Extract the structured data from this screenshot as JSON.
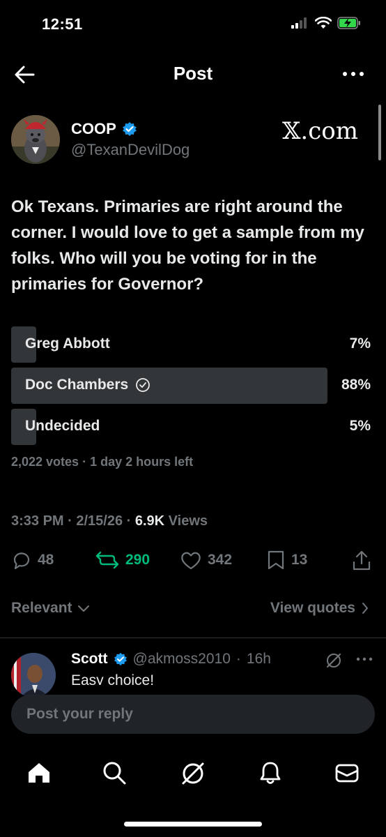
{
  "status_bar": {
    "time": "12:51"
  },
  "header": {
    "title": "Post"
  },
  "author": {
    "name": "COOP",
    "handle": "@TexanDevilDog",
    "verified": true
  },
  "watermark": "𝕏.com",
  "post": {
    "text": "Ok Texans. Primaries are right around the corner. I would love to get a sample from my folks. Who will you be voting for in the primaries for Governor?"
  },
  "poll": {
    "options": [
      {
        "label": "Greg Abbott",
        "percent": "7%",
        "fraction": 0.07
      },
      {
        "label": "Doc Chambers",
        "percent": "88%",
        "fraction": 0.88,
        "winner": true
      },
      {
        "label": "Undecided",
        "percent": "5%",
        "fraction": 0.05
      }
    ],
    "meta": "2,022 votes · 1 day 2 hours left"
  },
  "meta": {
    "time_date": "3:33 PM · 2/15/26 · ",
    "views_count": "6.9K",
    "views_label": " Views"
  },
  "actions": {
    "replies": "48",
    "reposts": "290",
    "likes": "342",
    "bookmarks": "13"
  },
  "colors": {
    "repost_green": "#00ba7c",
    "verified_blue": "#1d9bf0",
    "muted": "#71767b"
  },
  "sort": {
    "label": "Relevant",
    "view_quotes": "View quotes"
  },
  "reply": {
    "name": "Scott",
    "handle": "@akmoss2010",
    "time": "16h",
    "text": "Easy choice!"
  },
  "reply_box": {
    "placeholder": "Post your reply"
  },
  "nav": [
    "home-icon",
    "search-icon",
    "grok-icon",
    "notifications-icon",
    "messages-icon"
  ]
}
